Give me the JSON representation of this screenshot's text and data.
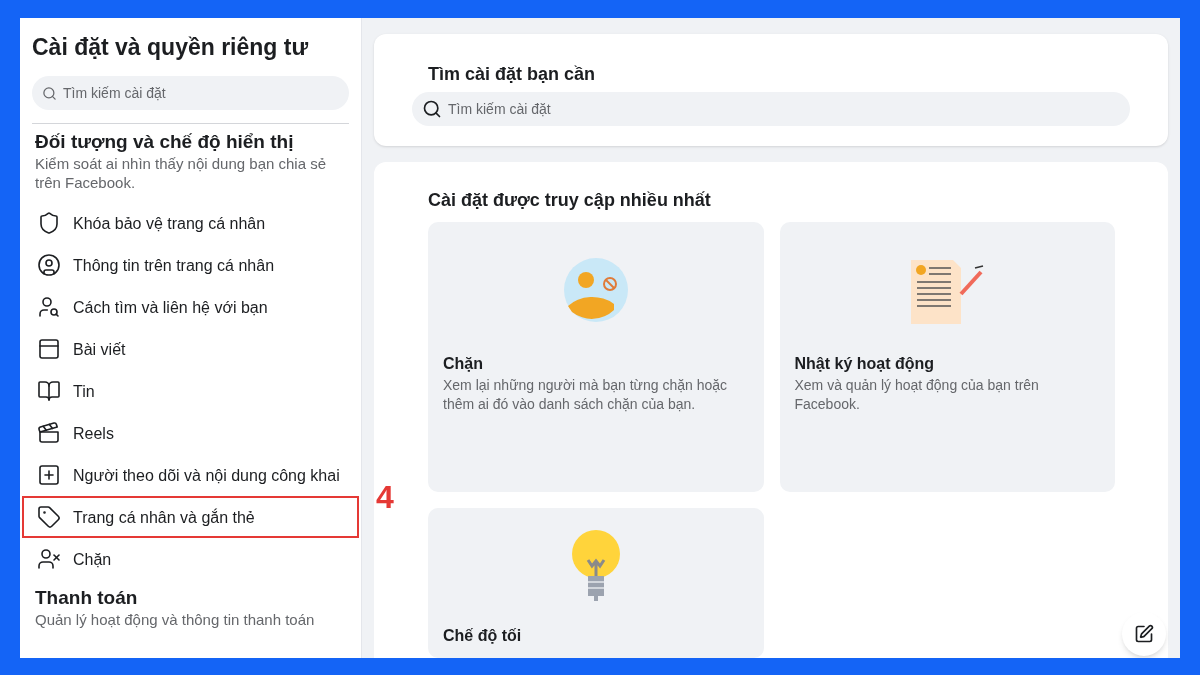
{
  "sidebar": {
    "title": "Cài đặt và quyền riêng tư",
    "search": {
      "placeholder": "Tìm kiếm cài đặt"
    },
    "sections": [
      {
        "heading": "Đối tượng và chế độ hiển thị",
        "description": "Kiểm soát ai nhìn thấy nội dung bạn chia sẻ trên Facebook.",
        "items": [
          {
            "kind": "shield",
            "label": "Khóa bảo vệ trang cá nhân",
            "highlighted": false
          },
          {
            "kind": "profile",
            "label": "Thông tin trên trang cá nhân",
            "highlighted": false
          },
          {
            "kind": "find",
            "label": "Cách tìm và liên hệ với bạn",
            "highlighted": false
          },
          {
            "kind": "posts",
            "label": "Bài viết",
            "highlighted": false
          },
          {
            "kind": "stories",
            "label": "Tin",
            "highlighted": false
          },
          {
            "kind": "reels",
            "label": "Reels",
            "highlighted": false
          },
          {
            "kind": "followers",
            "label": "Người theo dõi và nội dung công khai",
            "highlighted": false
          },
          {
            "kind": "tag",
            "label": "Trang cá nhân và gắn thẻ",
            "highlighted": true
          },
          {
            "kind": "block",
            "label": "Chặn",
            "highlighted": false
          }
        ]
      },
      {
        "heading": "Thanh toán",
        "description": "Quản lý hoạt động và thông tin thanh toán"
      }
    ]
  },
  "annotation": "4",
  "search_card": {
    "title": "Tìm cài đặt bạn cần",
    "search": {
      "placeholder": "Tìm kiếm cài đặt"
    }
  },
  "most_visited": {
    "title": "Cài đặt được truy cập nhiều nhất",
    "tiles": [
      {
        "kind": "block",
        "title": "Chặn",
        "description": "Xem lại những người mà bạn từng chặn hoặc thêm ai đó vào danh sách chặn của bạn."
      },
      {
        "kind": "activity",
        "title": "Nhật ký hoạt động",
        "description": "Xem và quản lý hoạt động của bạn trên Facebook."
      },
      {
        "kind": "dark",
        "title": "Chế độ tối"
      }
    ]
  }
}
